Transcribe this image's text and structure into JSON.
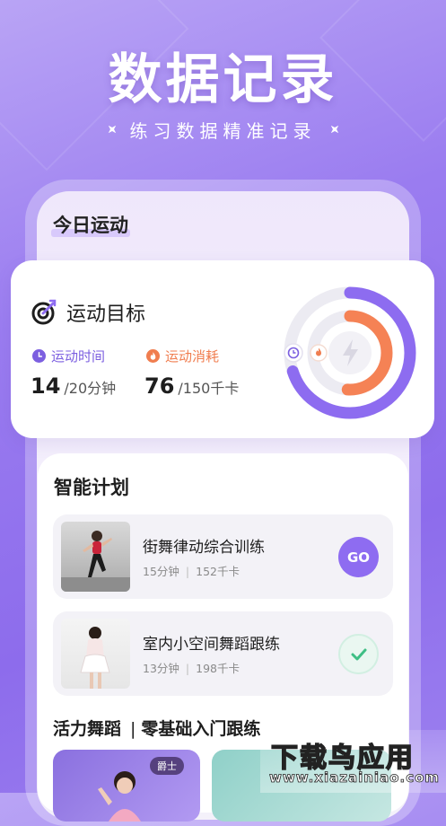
{
  "hero": {
    "title": "数据记录",
    "subtitle": "练习数据精准记录"
  },
  "today": {
    "title": "今日运动"
  },
  "goal": {
    "title": "运动目标",
    "time_label": "运动时间",
    "cal_label": "运动消耗",
    "time_value": "14",
    "time_unit": "/20分钟",
    "cal_value": "76",
    "cal_unit": "/150千卡",
    "time_progress": 0.7,
    "cal_progress": 0.51
  },
  "plan": {
    "title": "智能计划",
    "items": [
      {
        "name": "街舞律动综合训练",
        "duration": "15分钟",
        "calories": "152千卡",
        "action": "GO"
      },
      {
        "name": "室内小空间舞蹈跟练",
        "duration": "13分钟",
        "calories": "198千卡",
        "action": "done"
      }
    ]
  },
  "section2": {
    "left": "活力舞蹈",
    "right": "零基础入门跟练"
  },
  "covers": [
    {
      "tag": "爵士"
    }
  ],
  "watermark": {
    "line1": "下载鸟应用",
    "line2": "www.xiazainiao.com"
  },
  "colors": {
    "accent": "#8e6cf1",
    "calorie": "#f07d4f",
    "done": "#3fbf85"
  }
}
